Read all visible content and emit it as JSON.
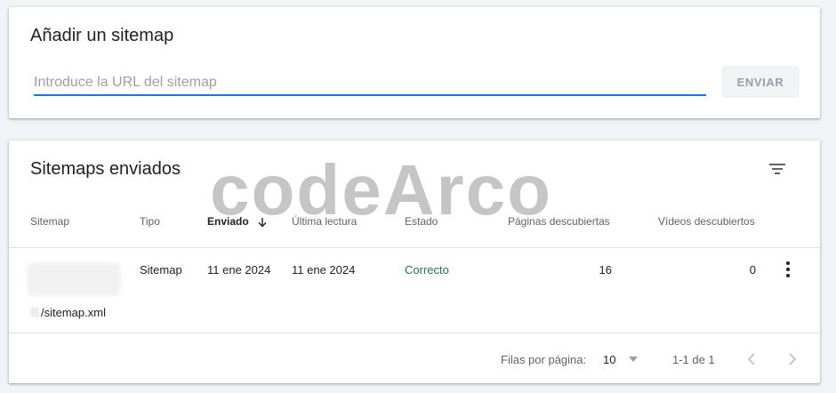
{
  "add_section": {
    "title": "Añadir un sitemap",
    "input_placeholder": "Introduce la URL del sitemap",
    "submit_label": "ENVIAR"
  },
  "submitted_section": {
    "title": "Sitemaps enviados",
    "columns": [
      "Sitemap",
      "Tipo",
      "Enviado",
      "Última lectura",
      "Estado",
      "Páginas descubiertas",
      "Vídeos descubiertos"
    ],
    "sorted_column": "Enviado",
    "rows": [
      {
        "sitemap": "/sitemap.xml",
        "type": "Sitemap",
        "submitted": "11 ene 2024",
        "last_read": "11 ene 2024",
        "status": "Correcto",
        "pages": "16",
        "videos": "0"
      }
    ],
    "pagination": {
      "rows_per_page_label": "Filas por página:",
      "rows_per_page": "10",
      "range": "1-1 de 1"
    }
  },
  "watermark": "codeArco",
  "colors": {
    "accent": "#1a73e8",
    "status_ok": "#188038"
  }
}
